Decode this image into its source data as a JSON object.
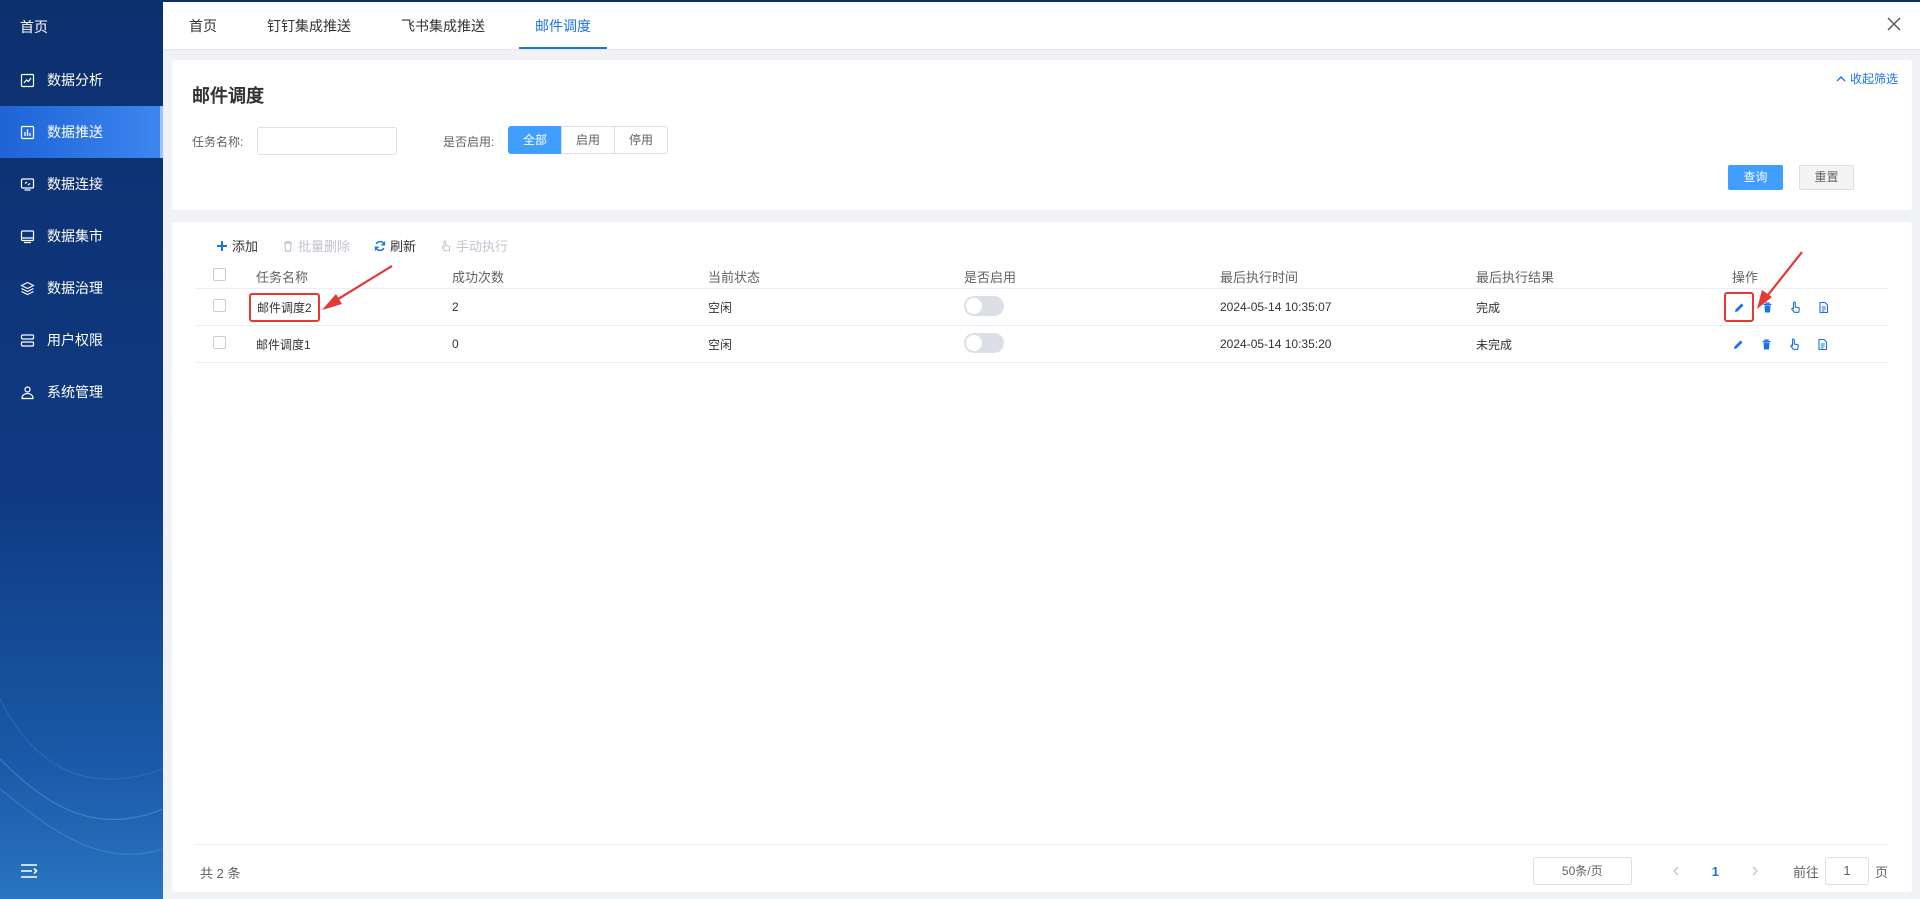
{
  "sidebar": {
    "home": "首页",
    "items": [
      {
        "label": "数据分析",
        "icon": "analytics-icon"
      },
      {
        "label": "数据推送",
        "icon": "push-icon"
      },
      {
        "label": "数据连接",
        "icon": "connection-icon"
      },
      {
        "label": "数据集市",
        "icon": "datamart-icon"
      },
      {
        "label": "数据治理",
        "icon": "governance-icon"
      },
      {
        "label": "用户权限",
        "icon": "user-permission-icon"
      },
      {
        "label": "系统管理",
        "icon": "system-icon"
      }
    ],
    "active_index": 1
  },
  "tabs": [
    {
      "label": "首页"
    },
    {
      "label": "钉钉集成推送"
    },
    {
      "label": "飞书集成推送"
    },
    {
      "label": "邮件调度"
    }
  ],
  "active_tab": 3,
  "filter": {
    "title": "邮件调度",
    "collapse_label": "收起筛选",
    "task_name_label": "任务名称:",
    "task_name_value": "",
    "enabled_label": "是否启用:",
    "enabled_options": [
      "全部",
      "启用",
      "停用"
    ],
    "enabled_selected": "全部",
    "query_label": "查询",
    "reset_label": "重置"
  },
  "toolbar": {
    "add": "添加",
    "batch_delete": "批量删除",
    "refresh": "刷新",
    "manual_run": "手动执行"
  },
  "table": {
    "columns": [
      "任务名称",
      "成功次数",
      "当前状态",
      "是否启用",
      "最后执行时间",
      "最后执行结果",
      "操作"
    ],
    "rows": [
      {
        "name": "邮件调度2",
        "success_count": "2",
        "status": "空闲",
        "enabled": false,
        "last_time": "2024-05-14 10:35:07",
        "last_result": "完成"
      },
      {
        "name": "邮件调度1",
        "success_count": "0",
        "status": "空闲",
        "enabled": false,
        "last_time": "2024-05-14 10:35:20",
        "last_result": "未完成"
      }
    ]
  },
  "pagination": {
    "total": "共 2 条",
    "page_size": "50条/页",
    "current_page": "1",
    "goto_label": "前往",
    "goto_value": "1",
    "page_suffix": "页"
  },
  "colors": {
    "primary": "#409eff",
    "sidebar": "#0f3a82",
    "annotation": "#e53935"
  }
}
